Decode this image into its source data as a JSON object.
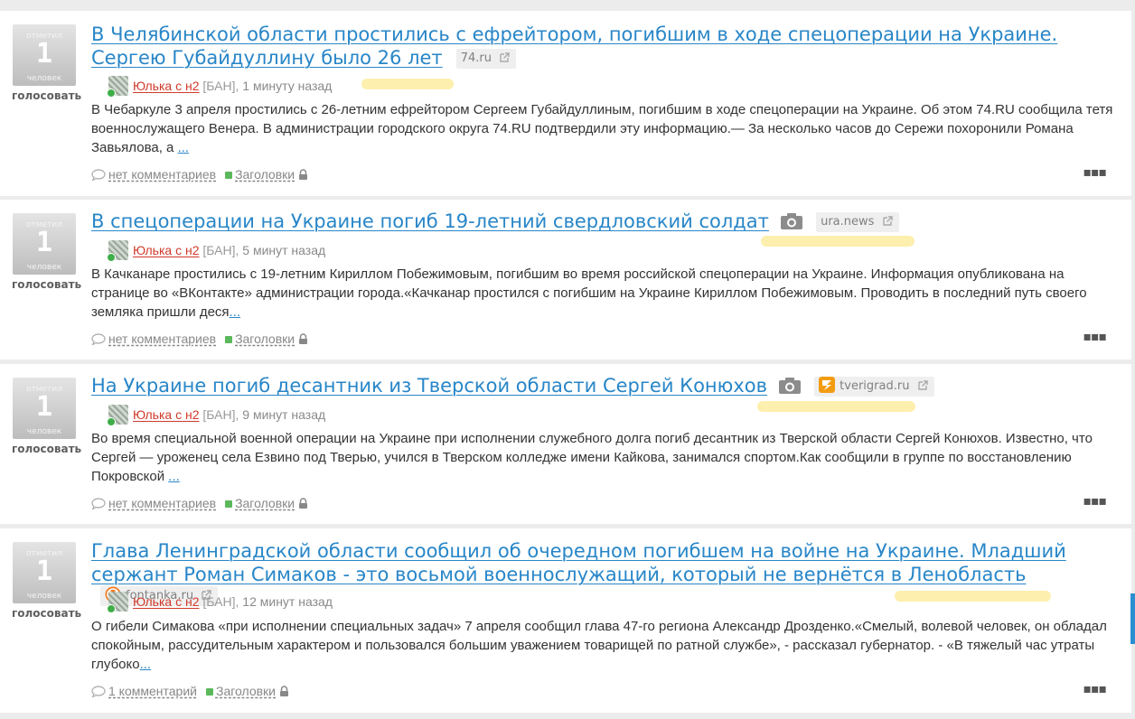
{
  "vote": {
    "top": "отметил",
    "bottom": "человек",
    "action": "голосовать"
  },
  "stories": [
    {
      "votes": "1",
      "title": "В Челябинской области простились с ефрейтором, погибшим в ходе спецоперации на Украине. Сергею Губайдуллину было 26 лет",
      "has_camera": false,
      "domain": "74.ru",
      "user": "Юлька с н2",
      "ban": "[БАН],",
      "time": "1 минуту назад",
      "excerpt": "В Чебаркуле 3 апреля простились с 26-летним ефрейтором Сергеем Губайдуллиным, погибшим в ходе спецоперации на Украине. Об этом 74.RU сообщила тетя военнослужащего Венера. В администрации городского округа 74.RU подтвердили эту информацию.— За несколько часов до Сережи похоронили Романа Завьялова, а",
      "more": "...",
      "comments": "нет комментариев",
      "tag": "Заголовки"
    },
    {
      "votes": "1",
      "title": "В спецоперации на Украине погиб 19-летний свердловский солдат",
      "has_camera": true,
      "domain": "ura.news",
      "user": "Юлька с н2",
      "ban": "[БАН],",
      "time": "5 минут назад",
      "excerpt": "В Качканаре простились с 19-летним Кириллом Побежимовым, погибшим во время российской спецоперации на Украине. Информация опубликована на странице во «ВКонтакте» администрации города.«Качканар простился с погибшим на Украине Кириллом Побежимовым. Проводить в последний путь своего земляка пришли деся",
      "more": "...",
      "comments": "нет комментариев",
      "tag": "Заголовки"
    },
    {
      "votes": "1",
      "title": "На Украине погиб десантник из Тверской области Сергей Конюхов",
      "has_camera": true,
      "domain": "tverigrad.ru",
      "user": "Юлька с н2",
      "ban": "[БАН],",
      "time": "9 минут назад",
      "excerpt": "Во время специальной военной операции на Украине при исполнении служебного долга погиб десантник из Тверской области Сергей Конюхов. Известно, что Сергей — уроженец села Езвино под Тверью, учился в Тверском колледже имени Кайкова, занимался спортом.Как сообщили в группе по восстановлению Покровской",
      "more": "...",
      "comments": "нет комментариев",
      "tag": "Заголовки"
    },
    {
      "votes": "1",
      "title": "Глава Ленинградской области сообщил об очередном погибшем на войне на Украине. Младший сержант Роман Симаков - это восьмой военнослужащий, который не вернётся в Ленобласть",
      "has_camera": false,
      "domain": "fontanka.ru",
      "user": "Юлька с н2",
      "ban": "[БАН],",
      "time": "12 минут назад",
      "excerpt": "О гибели Симакова «при исполнении специальных задач» 7 апреля сообщил глава 47-го региона Александр Дрозденко.«Смелый, волевой человек, он обладал спокойным, рассудительным характером и пользовался большим уважением товарищей по ратной службе», - рассказал губернатор. - «В тяжелый час утраты глубоко",
      "more": "...",
      "comments": "1 комментарий",
      "tag": "Заголовки"
    }
  ],
  "colors": {
    "link": "#2886c8",
    "user": "#d03a2a",
    "highlight": "#fdeeaa"
  }
}
